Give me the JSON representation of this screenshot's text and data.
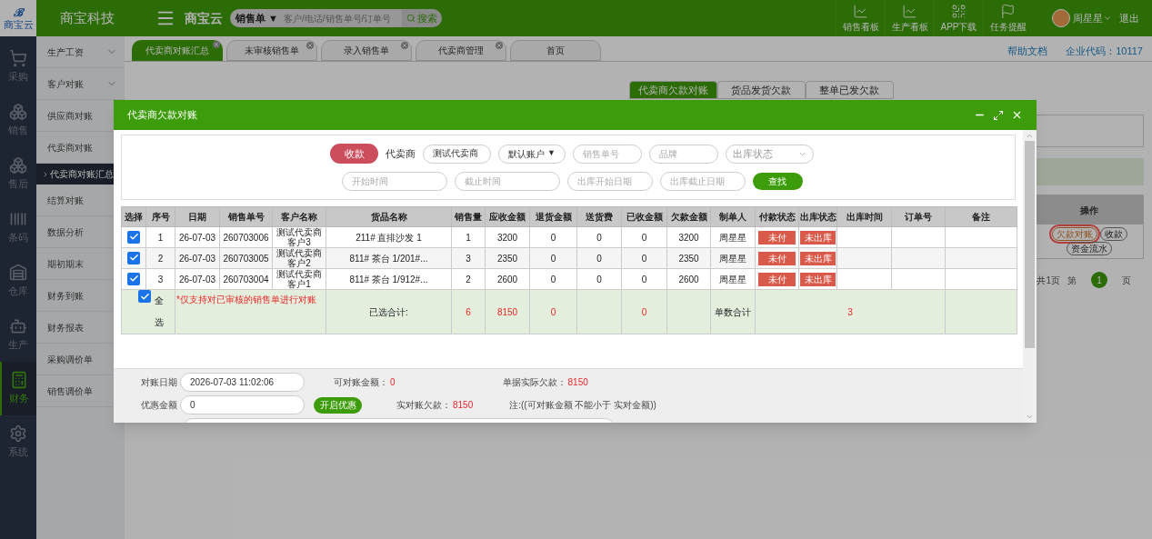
{
  "top_bar": {
    "corner_mark": "ℬ",
    "corner_logo": "商宝云",
    "brand": "商宝科技",
    "logo": "商宝云",
    "search": {
      "scope": "销售单 ▼",
      "placeholder": "客户/电话/销售单号/订单号",
      "button": "搜索"
    },
    "actions": [
      {
        "label": "销售看板"
      },
      {
        "label": "生产看板"
      },
      {
        "label": "APP下载"
      },
      {
        "label": "任务提醒"
      }
    ],
    "user": {
      "name": "周星星",
      "logout": "退出"
    }
  },
  "nav": [
    {
      "label": "采购",
      "selected": false
    },
    {
      "label": "销售",
      "selected": false
    },
    {
      "label": "售后",
      "selected": false
    },
    {
      "label": "条码",
      "selected": false
    },
    {
      "label": "仓库",
      "selected": false
    },
    {
      "label": "生产",
      "selected": false
    },
    {
      "label": "财务",
      "selected": true
    },
    {
      "label": "系统",
      "selected": false
    }
  ],
  "submenu": [
    {
      "label": "生产工资",
      "collapsible": true,
      "selected": false
    },
    {
      "label": "客户对账",
      "collapsible": true,
      "selected": false
    },
    {
      "label": "供应商对账",
      "collapsible": false,
      "selected": false
    },
    {
      "label": "代卖商对账",
      "collapsible": false,
      "selected": false,
      "children": [
        {
          "label": "代卖商对账汇总",
          "selected": true
        }
      ]
    },
    {
      "label": "结算对账",
      "collapsible": false,
      "selected": false
    },
    {
      "label": "数据分析",
      "collapsible": false,
      "selected": false
    },
    {
      "label": "期初期末",
      "collapsible": false,
      "selected": false
    },
    {
      "label": "财务到账",
      "collapsible": false,
      "selected": false
    },
    {
      "label": "财务报表",
      "collapsible": false,
      "selected": false
    },
    {
      "label": "采购调价单",
      "collapsible": false,
      "selected": false
    },
    {
      "label": "销售调价单",
      "collapsible": false,
      "selected": false
    }
  ],
  "tabs": [
    {
      "label": "代卖商对账汇总",
      "selected": true,
      "closable": true
    },
    {
      "label": "未审核销售单",
      "selected": false,
      "closable": true
    },
    {
      "label": "录入销售单",
      "selected": false,
      "closable": true
    },
    {
      "label": "代卖商管理",
      "selected": false,
      "closable": true
    },
    {
      "label": "首页",
      "selected": false,
      "closable": false
    }
  ],
  "help_link": "帮助文档",
  "company_code": "企业代码：10117",
  "sub_tabs": [
    {
      "label": "代卖商欠款对账",
      "selected": true
    },
    {
      "label": "货品发货欠款",
      "selected": false
    },
    {
      "label": "整单已发欠款",
      "selected": false
    }
  ],
  "background_table": {
    "action_column": "操作",
    "actions": [
      {
        "label": "欠款对账",
        "highlighted": true
      },
      {
        "label": "收款",
        "highlighted": false
      },
      {
        "label": "资金流水",
        "highlighted": false
      }
    ],
    "pagination": {
      "total": "共1页",
      "page_label": "第",
      "page": "1",
      "suffix": "页"
    }
  },
  "modal": {
    "title": "代卖商欠款对账",
    "filters": {
      "collect_button": "收款",
      "vendor_label": "代卖商",
      "vendor_value": "测试代卖商",
      "account": "默认账户",
      "account_caret": "▼",
      "order_no_placeholder": "销售单号",
      "brand_placeholder": "品牌",
      "status_placeholder": "出库状态",
      "start_placeholder": "开始时间",
      "end_placeholder": "截止时间",
      "out_start_placeholder": "出库开始日期",
      "out_end_placeholder": "出库截止日期",
      "search_button": "查找"
    },
    "columns": [
      "选择",
      "序号",
      "日期",
      "销售单号",
      "客户名称",
      "货品名称",
      "销售量",
      "应收金额",
      "退货金额",
      "送货费",
      "已收金额",
      "欠款金额",
      "制单人",
      "付款状态",
      "出库状态",
      "出库时间",
      "订单号",
      "备注"
    ],
    "rows": [
      {
        "checked": true,
        "no": "1",
        "date": "26-07-03",
        "order": "260703006",
        "customer": "测试代卖商客户3",
        "goods": "211# 直排沙发 1",
        "qty": "1",
        "receivable": "3200",
        "returns": "0",
        "delivery": "0",
        "received": "0",
        "owed": "3200",
        "maker": "周星星",
        "pay_status": "未付",
        "ship_status": "未出库"
      },
      {
        "checked": true,
        "no": "2",
        "date": "26-07-03",
        "order": "260703005",
        "customer": "测试代卖商客户2",
        "goods": "811# 茶台 1/201#...",
        "qty": "3",
        "receivable": "2350",
        "returns": "0",
        "delivery": "0",
        "received": "0",
        "owed": "2350",
        "maker": "周星星",
        "pay_status": "未付",
        "ship_status": "未出库"
      },
      {
        "checked": true,
        "no": "3",
        "date": "26-07-03",
        "order": "260703004",
        "customer": "测试代卖商客户1",
        "goods": "811# 茶台 1/912#...",
        "qty": "2",
        "receivable": "2600",
        "returns": "0",
        "delivery": "0",
        "received": "0",
        "owed": "2600",
        "maker": "周星星",
        "pay_status": "未付",
        "ship_status": "未出库"
      }
    ],
    "summary": {
      "checked": true,
      "select_all": "全选",
      "note": "*仅支持对已审核的销售单进行对账",
      "label": "已选合计:",
      "qty": "6",
      "receivable": "8150",
      "returns": "0",
      "received": "0",
      "count_label": "单数合计",
      "count": "3"
    },
    "footer": {
      "date_label": "对账日期",
      "date": "2026-07-03 11:02:06",
      "available_label": "可对账金额：",
      "available": "0",
      "actual_label": "单据实际欠款：",
      "actual": "8150",
      "discount_label": "优惠金额",
      "discount": "0",
      "discount_button": "开启优惠",
      "real_label": "实对账欠款：",
      "real": "8150",
      "note": "注:((可对账金额 不能小于 实对金额))"
    }
  }
}
